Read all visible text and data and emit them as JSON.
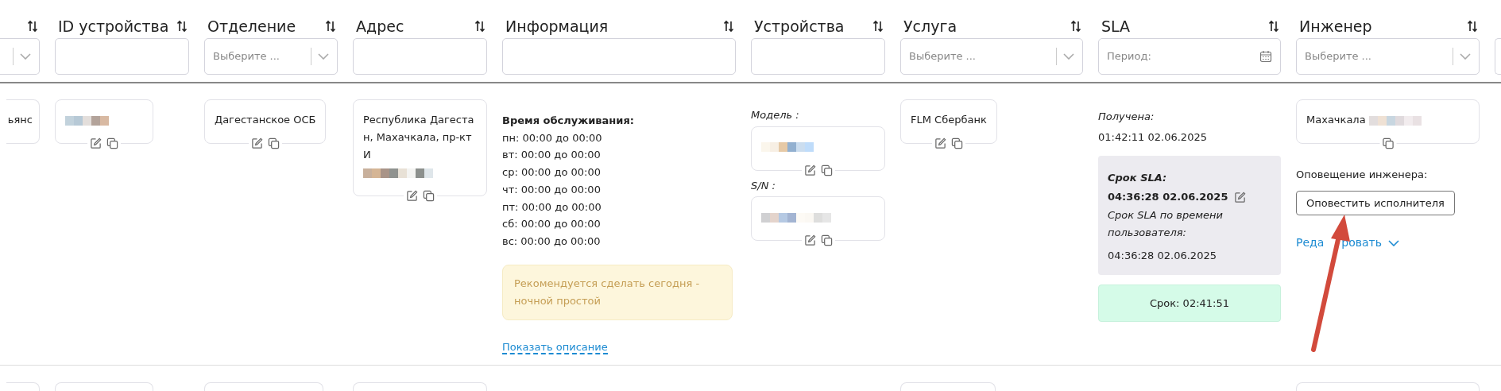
{
  "columns": [
    {
      "sortable": true,
      "filter": {
        "kind": "select"
      }
    },
    {
      "title": "ID устройства",
      "sortable": true,
      "filter": {
        "kind": "text"
      }
    },
    {
      "title": "Отделение",
      "sortable": true,
      "filter": {
        "kind": "select",
        "placeholder": "Выберите ..."
      }
    },
    {
      "title": "Адрес",
      "sortable": true,
      "filter": {
        "kind": "text"
      }
    },
    {
      "title": "Информация",
      "sortable": true,
      "filter": {
        "kind": "text"
      }
    },
    {
      "title": "Устройства",
      "sortable": true,
      "filter": {
        "kind": "text"
      }
    },
    {
      "title": "Услуга",
      "sortable": true,
      "filter": {
        "kind": "select",
        "placeholder": "Выберите ..."
      }
    },
    {
      "title": "SLA",
      "sortable": true,
      "filter": {
        "kind": "date",
        "placeholder": "Период:"
      }
    },
    {
      "title": "Инженер",
      "sortable": true,
      "filter": {
        "kind": "select",
        "placeholder": "Выберите ..."
      }
    },
    {
      "filter": {
        "kind": "text"
      }
    }
  ],
  "row": [
    {
      "kind": "card",
      "text": "ьянс",
      "redacted": false
    },
    {
      "kind": "card",
      "redacted": true,
      "edit": true,
      "copy": true
    },
    {
      "kind": "card",
      "text": "Дагестанское ОСБ",
      "redacted": false,
      "edit": true,
      "copy": true
    },
    {
      "kind": "card",
      "text": "Республика Дагестан, Махачкала, пр-кт И",
      "redacted": true,
      "edit": true,
      "copy": true
    },
    {
      "kind": "schedule",
      "heading": "Время обслуживания:",
      "lines": [
        "пн: 00:00 до 00:00",
        "вт: 00:00 до 00:00",
        "ср: 00:00 до 00:00",
        "чт: 00:00 до 00:00",
        "пт: 00:00 до 00:00",
        "сб: 00:00 до 00:00",
        "вс: 00:00 до 00:00"
      ],
      "notice": "Рекомендуется сделать сегодня - ночной простой",
      "link": "Показать описание"
    },
    {
      "kind": "devices",
      "fields": [
        {
          "label": "Модель :",
          "redacted": true,
          "edit": true,
          "copy": true
        },
        {
          "label": "S/N :",
          "redacted": true,
          "edit": true,
          "copy": true
        }
      ]
    },
    {
      "kind": "card",
      "text": "FLM Сбербанк",
      "redacted": false,
      "edit": true,
      "copy": true
    },
    {
      "kind": "sla",
      "received_label": "Получена:",
      "received": "01:42:11 02.06.2025",
      "deadline_label": "Срок SLA:",
      "deadline": "04:36:28 02.06.2025",
      "user_label": "Срок SLA по времени пользователя:",
      "user_deadline": "04:36:28 02.06.2025",
      "remaining": "Срок: 02:41:51"
    },
    {
      "kind": "engineer",
      "text": "Махачкала",
      "redacted": true,
      "copy": true,
      "notify_label": "Оповещение инженера:",
      "notify_button": "Оповестить исполнителя",
      "edit_link_parts": [
        "Реда",
        "ровать"
      ]
    },
    {
      "kind": "empty"
    }
  ],
  "next_row": [
    {
      "kind": "card"
    },
    {
      "kind": "card"
    },
    {
      "kind": "card"
    },
    {
      "kind": "card"
    },
    {
      "kind": "empty"
    },
    {
      "kind": "empty"
    },
    {
      "kind": "card"
    },
    {
      "kind": "empty"
    },
    {
      "kind": "card"
    },
    {
      "kind": "empty"
    }
  ],
  "annotation": {
    "kind": "arrow"
  }
}
